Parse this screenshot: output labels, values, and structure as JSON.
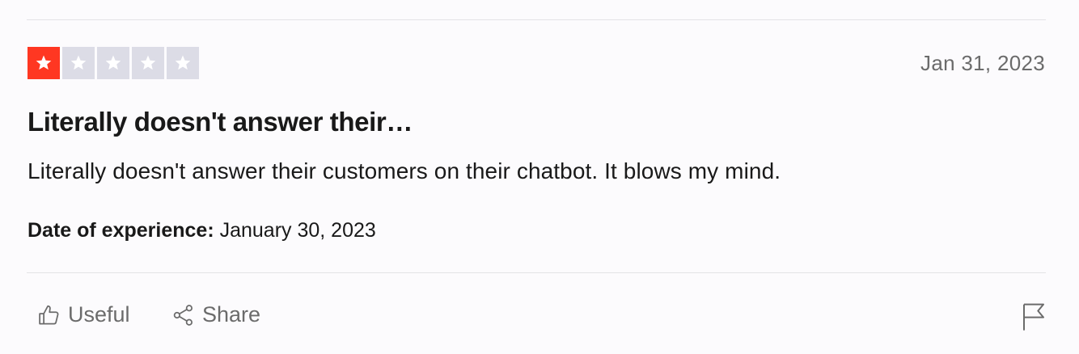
{
  "review": {
    "rating": 1,
    "rating_max": 5,
    "star_active_color": "#ff3722",
    "star_inactive_color": "#dcdce6",
    "date_posted": "Jan 31, 2023",
    "title": "Literally doesn't answer their…",
    "body": "Literally doesn't answer their customers on their chatbot. It blows my mind.",
    "experience_label": "Date of experience:",
    "experience_date": "January 30, 2023"
  },
  "actions": {
    "useful_label": "Useful",
    "useful_icon": "thumbs-up-icon",
    "share_label": "Share",
    "share_icon": "share-icon",
    "flag_icon": "flag-icon"
  }
}
